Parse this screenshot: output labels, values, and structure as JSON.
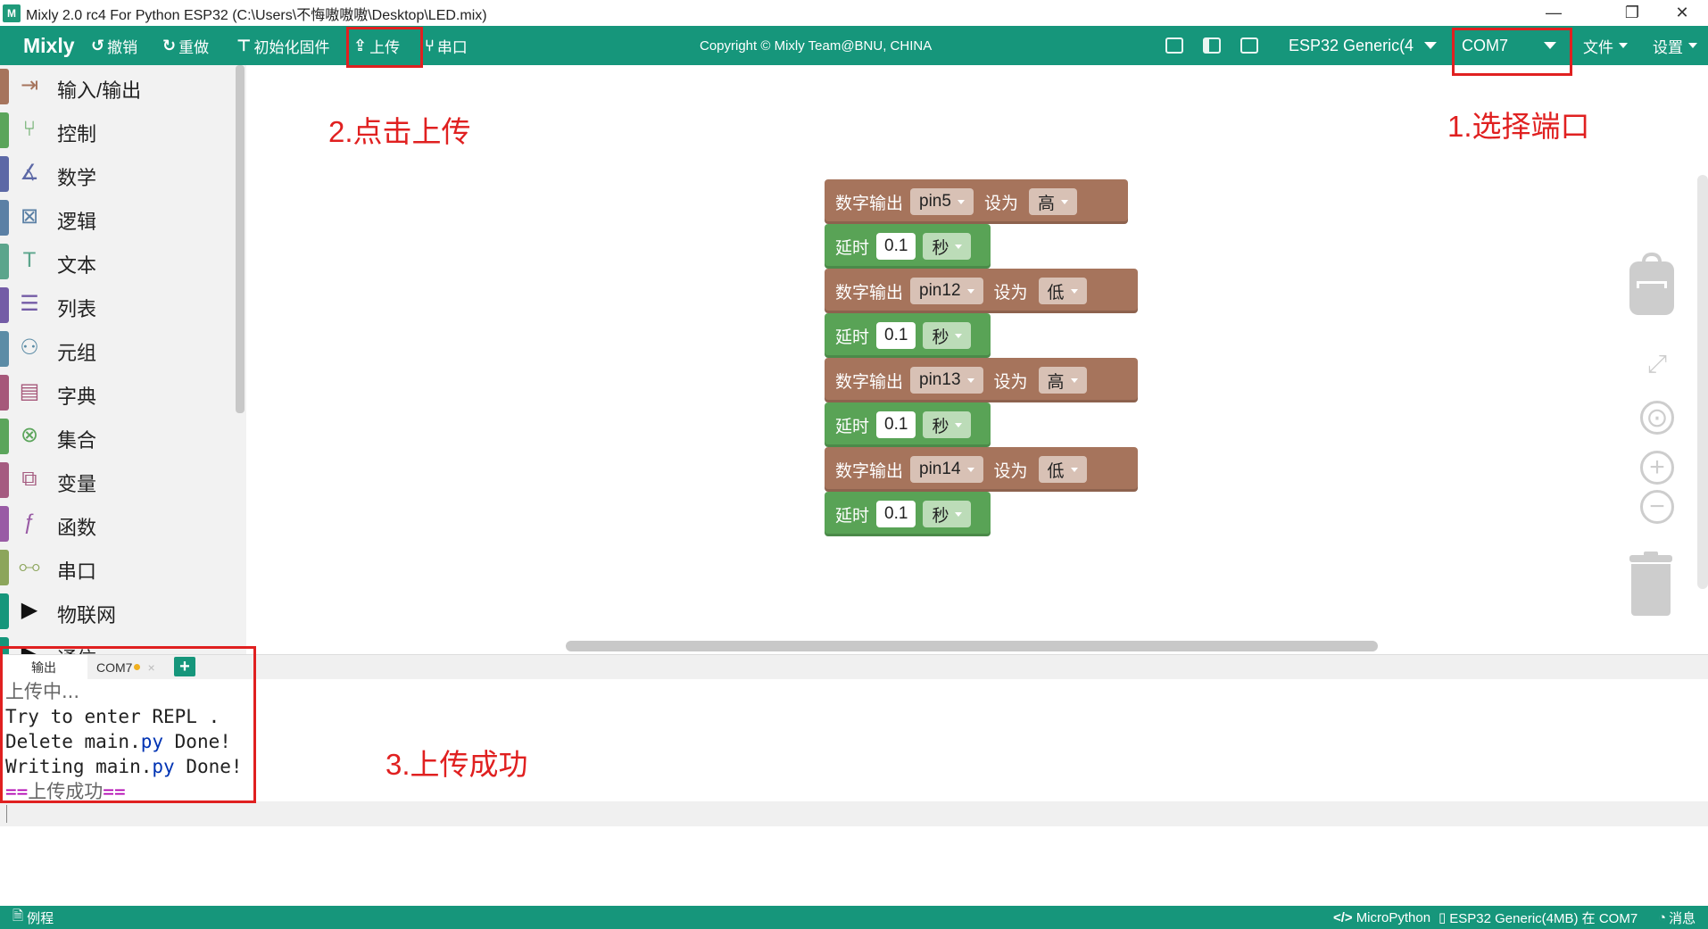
{
  "window": {
    "title": "Mixly 2.0 rc4 For Python ESP32 (C:\\Users\\不悔嗷嗷嗷\\Desktop\\LED.mix)",
    "app_icon_text": "M",
    "minimize": "—",
    "maximize": "❐",
    "close": "✕"
  },
  "toolbar": {
    "brand": "Mixly",
    "undo": "撤销",
    "redo": "重做",
    "init_firmware": "初始化固件",
    "upload": "上传",
    "serial": "串口",
    "copyright": "Copyright © Mixly Team@BNU, CHINA",
    "board": "ESP32 Generic(4",
    "port": "COM7",
    "file": "文件",
    "settings": "设置"
  },
  "sidebar": {
    "items": [
      {
        "label": "输入/输出",
        "color": "#a6745c",
        "icon": "input-output-icon"
      },
      {
        "label": "控制",
        "color": "#5ba55b",
        "icon": "control-icon"
      },
      {
        "label": "数学",
        "color": "#5c68a6",
        "icon": "math-icon"
      },
      {
        "label": "逻辑",
        "color": "#5b80a5",
        "icon": "logic-icon"
      },
      {
        "label": "文本",
        "color": "#5ba58c",
        "icon": "text-icon"
      },
      {
        "label": "列表",
        "color": "#745ca6",
        "icon": "list-icon"
      },
      {
        "label": "元组",
        "color": "#5c8ca6",
        "icon": "tuple-icon"
      },
      {
        "label": "字典",
        "color": "#a6587a",
        "icon": "dict-icon"
      },
      {
        "label": "集合",
        "color": "#5ba55b",
        "icon": "set-icon"
      },
      {
        "label": "变量",
        "color": "#a55b80",
        "icon": "variable-icon"
      },
      {
        "label": "函数",
        "color": "#995ba5",
        "icon": "function-icon"
      },
      {
        "label": "串口",
        "color": "#8ca55b",
        "icon": "serial-icon"
      },
      {
        "label": "物联网",
        "color": "#16967b",
        "icon": "iot-icon"
      },
      {
        "label": "通信",
        "color": "#16967b",
        "icon": "comm-icon"
      }
    ]
  },
  "annotations": {
    "select_port": "1.选择端口",
    "click_upload": "2.点击上传",
    "upload_success": "3.上传成功"
  },
  "blocks": {
    "digital_out": "数字输出",
    "set_to": "设为",
    "delay": "延时",
    "sec": "秒",
    "rows": [
      {
        "pin": "pin5",
        "level": "高",
        "delay": "0.1"
      },
      {
        "pin": "pin12",
        "level": "低",
        "delay": "0.1"
      },
      {
        "pin": "pin13",
        "level": "高",
        "delay": "0.1"
      },
      {
        "pin": "pin14",
        "level": "低",
        "delay": "0.1"
      }
    ]
  },
  "output": {
    "tab_output": "输出",
    "tab_com": "COM7",
    "tab_close": "×",
    "add": "+",
    "lines": {
      "l1": "上传中...",
      "l2": "Try to enter REPL .",
      "l3a": "Delete main.",
      "l3b": "py",
      "l3c": " Done!",
      "l4a": "Writing main.",
      "l4b": "py",
      "l4c": " Done!",
      "l5a": "==",
      "l5b": "上传成功",
      "l5c": "=="
    }
  },
  "status": {
    "examples": "例程",
    "language": "MicroPython",
    "board_port": "ESP32 Generic(4MB) 在 COM7",
    "messages": "消息"
  }
}
